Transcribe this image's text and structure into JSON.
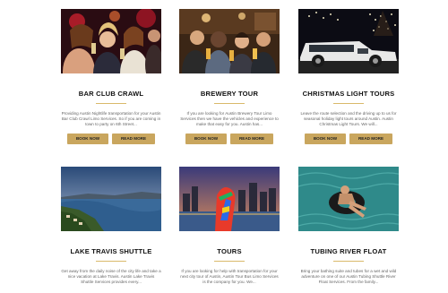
{
  "cards": [
    {
      "title": "BAR CLUB CRAWL",
      "desc": "Providing Austin Nightlife transportation for your Austin Bar Club Crawl Limo Services. So if you are coming in town to party on 6th Street...",
      "book": "BOOK NOW",
      "more": "READ MORE"
    },
    {
      "title": "BREWERY TOUR",
      "desc": "If you are looking for Austin Brewery Tour Limo Services then we have the vehicles and experience to make that easy for you. Austin has...",
      "book": "BOOK NOW",
      "more": "READ MORE"
    },
    {
      "title": "CHRISTMAS LIGHT TOURS",
      "desc": "Leave the route selection and the driving up to us for seasonal holiday light tours around Austin. Austin Christmas Light Tours. We will...",
      "book": "BOOK NOW",
      "more": "READ MORE"
    },
    {
      "title": "LAKE TRAVIS SHUTTLE",
      "desc": "Get away from the daily noise of the city life and take a nice vacation at Lake Travis. Austin Lake Travis Shuttle Services provides every..."
    },
    {
      "title": "TOURS",
      "desc": "If you are looking for help with transportation for your next city tour of Austin, Austin Tour Bus Limo Services is the company for you. We..."
    },
    {
      "title": "TUBING RIVER FLOAT",
      "desc": "Bring your bathing suite and tubes for a wet and wild adventure on one of our Austin Tubing Shuttle River Float Services. From the family..."
    }
  ]
}
